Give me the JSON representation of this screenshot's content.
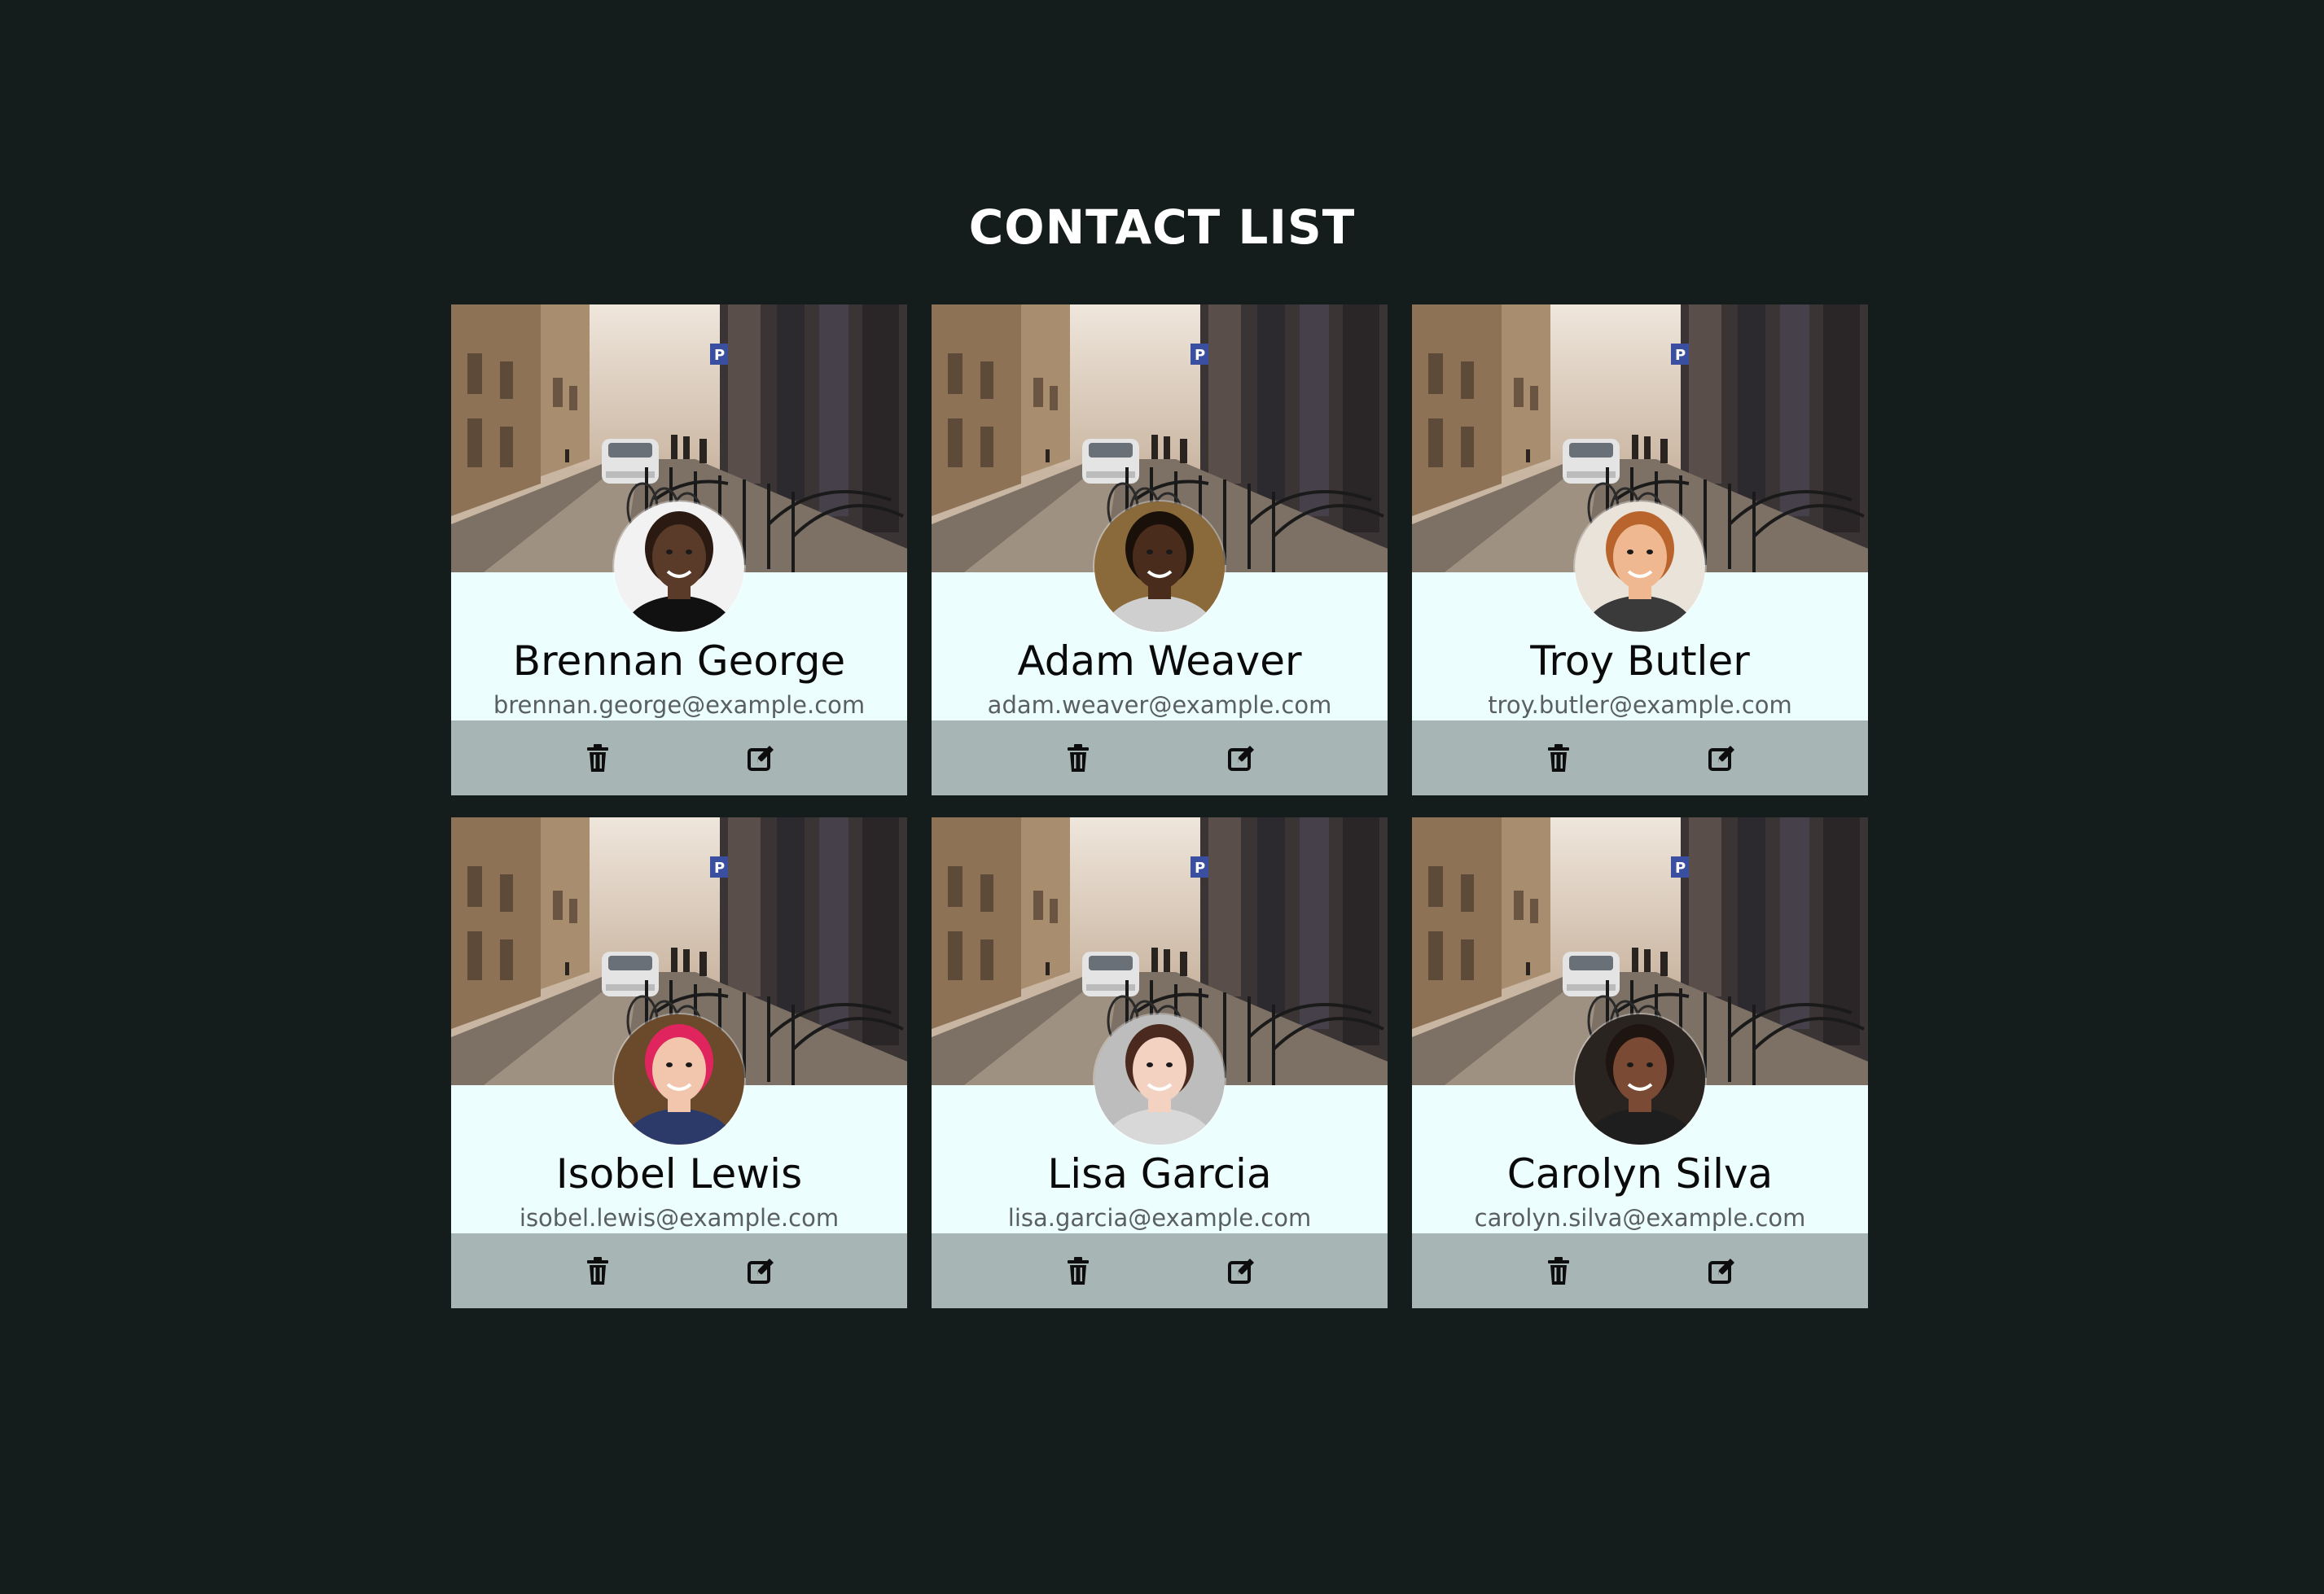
{
  "page": {
    "title": "CONTACT LIST"
  },
  "contacts": [
    {
      "name": "Brennan George",
      "email": "brennan.george@example.com",
      "skin": "#5a3a28",
      "hair": "#2a1a12",
      "shirt": "#111111",
      "bg": "#f2f2f2"
    },
    {
      "name": "Adam Weaver",
      "email": "adam.weaver@example.com",
      "skin": "#4a2c1c",
      "hair": "#1a100a",
      "shirt": "#cfcfcf",
      "bg": "#8a6a3a"
    },
    {
      "name": "Troy Butler",
      "email": "troy.butler@example.com",
      "skin": "#f0b890",
      "hair": "#b8642c",
      "shirt": "#3a3a3a",
      "bg": "#e9e3da"
    },
    {
      "name": "Isobel Lewis",
      "email": "isobel.lewis@example.com",
      "skin": "#f1c6ad",
      "hair": "#e0245e",
      "shirt": "#2c3a6a",
      "bg": "#6a4a2a"
    },
    {
      "name": "Lisa Garcia",
      "email": "lisa.garcia@example.com",
      "skin": "#f3d2c1",
      "hair": "#4a2a1e",
      "shirt": "#d8d8d8",
      "bg": "#bdbdbd"
    },
    {
      "name": "Carolyn Silva",
      "email": "carolyn.silva@example.com",
      "skin": "#7a4a34",
      "hair": "#1e1410",
      "shirt": "#1e1e1e",
      "bg": "#2a2420"
    }
  ],
  "icons": {
    "delete": "trash-icon",
    "edit": "edit-icon"
  }
}
